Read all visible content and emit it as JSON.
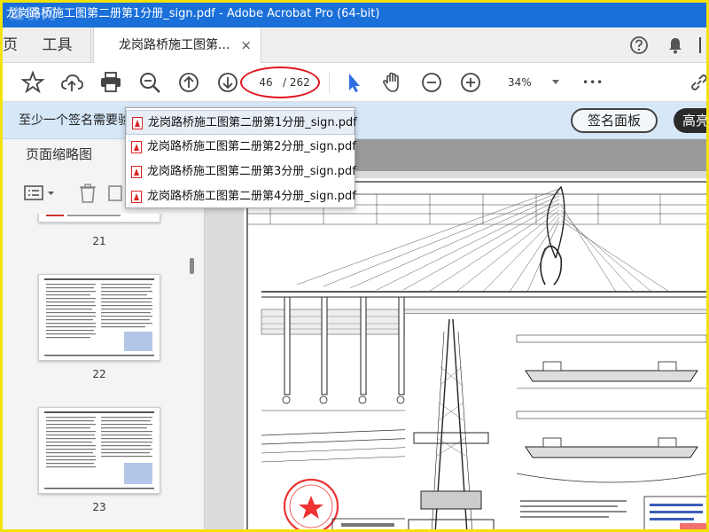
{
  "window": {
    "title": "龙岗路桥施工图第二册第1分册_sign.pdf - Adobe Acrobat Pro (64-bit)",
    "watermark": "道桥网"
  },
  "tabs": {
    "home_label": "页",
    "tools_label": "工具",
    "doc_label": "龙岗路桥施工图第...",
    "close_glyph": "×"
  },
  "toolbar": {
    "current_page": "46",
    "total_pages": "/ 262",
    "zoom": "34%",
    "more_glyph": "•••"
  },
  "banner": {
    "text": "至少一个签名需要验",
    "sig_panel_label": "签名面板",
    "highlight_label": "高亮"
  },
  "left_panel": {
    "title": "页面缩略图",
    "thumbnails": [
      {
        "page": "21"
      },
      {
        "page": "22"
      },
      {
        "page": "23"
      }
    ]
  },
  "dropdown": {
    "items": [
      {
        "label": "龙岗路桥施工图第二册第1分册_sign.pdf",
        "active": true
      },
      {
        "label": "龙岗路桥施工图第二册第2分册_sign.pdf",
        "active": false
      },
      {
        "label": "龙岗路桥施工图第二册第3分册_sign.pdf",
        "active": false
      },
      {
        "label": "龙岗路桥施工图第二册第4分册_sign.pdf",
        "active": false
      }
    ]
  },
  "colors": {
    "titlebar": "#1a6fd9",
    "highlight_frame": "#f2e20a",
    "annotation_red": "#e1141c",
    "banner": "#d6e7f8",
    "cursor_blue": "#2d6ee0"
  },
  "icons": [
    "star-icon",
    "cloud-upload-icon",
    "print-icon",
    "zoom-search-icon",
    "page-up-icon",
    "page-down-icon",
    "select-arrow-icon",
    "hand-icon",
    "zoom-out-icon",
    "zoom-in-icon",
    "more-icon",
    "help-icon",
    "bell-icon",
    "link-icon",
    "options-icon",
    "trash-icon",
    "pdf-file-icon"
  ]
}
